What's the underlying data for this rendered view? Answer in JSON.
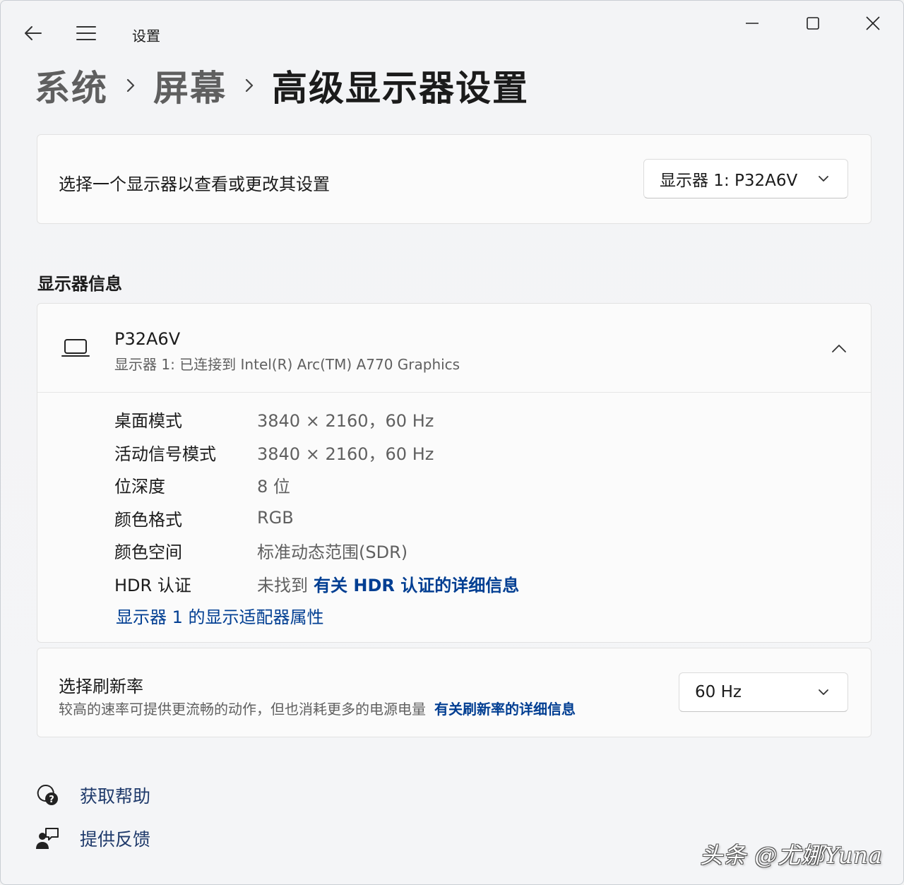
{
  "titlebar": {
    "app_title": "设置",
    "back_icon": "back-arrow-icon",
    "menu_icon": "hamburger-menu-icon",
    "window_controls": [
      "minimize-icon",
      "maximize-icon",
      "close-icon"
    ]
  },
  "breadcrumb": {
    "items": [
      "系统",
      "屏幕",
      "高级显示器设置"
    ],
    "separator_icon": "chevron-right-icon"
  },
  "monitor_select": {
    "label": "选择一个显示器以查看或更改其设置",
    "selected": "显示器 1: P32A6V"
  },
  "section": {
    "title": "显示器信息"
  },
  "monitor_info": {
    "icon": "laptop-icon",
    "name": "P32A6V",
    "subtitle": "显示器 1: 已连接到 Intel(R) Arc(TM) A770 Graphics",
    "rows": [
      {
        "label": "桌面模式",
        "value": "3840 × 2160，60 Hz"
      },
      {
        "label": "活动信号模式",
        "value": "3840 × 2160，60 Hz"
      },
      {
        "label": "位深度",
        "value": "8 位"
      },
      {
        "label": "颜色格式",
        "value": "RGB"
      },
      {
        "label": "颜色空间",
        "value": "标准动态范围(SDR)"
      },
      {
        "label": "HDR 认证",
        "value": "未找到",
        "link": "有关 HDR 认证的详细信息"
      }
    ],
    "adapter_link": "显示器 1 的显示适配器属性"
  },
  "refresh_rate": {
    "title": "选择刷新率",
    "description": "较高的速率可提供更流畅的动作，但也消耗更多的电源电量",
    "link": "有关刷新率的详细信息",
    "selected": "60 Hz"
  },
  "footer": {
    "help": "获取帮助",
    "feedback": "提供反馈"
  },
  "watermark": "头条 @尤娜Yuna",
  "colors": {
    "link": "#003e92",
    "background": "#f3f3f3",
    "card": "#fbfbfb"
  }
}
